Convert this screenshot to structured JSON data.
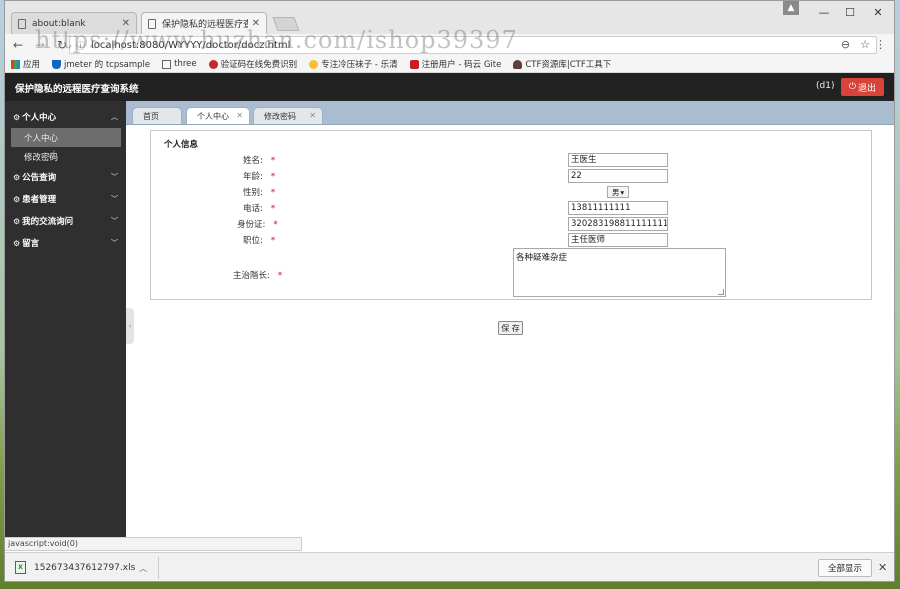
{
  "browser": {
    "tabs": [
      {
        "title": "about:blank"
      },
      {
        "title": "保护隐私的远程医疗查询"
      }
    ],
    "url": "localhost:8080/WYYYY/doctor/docz.html",
    "bookmarks": [
      {
        "label": "应用",
        "icon": "apps-icon"
      },
      {
        "label": "jmeter 的 tcpsample",
        "icon": "shield-icon"
      },
      {
        "label": "three",
        "icon": "page-icon"
      },
      {
        "label": "验证码在线免费识别",
        "icon": "captcha-icon"
      },
      {
        "label": "专注冷压袜子 - 乐清",
        "icon": "bird-icon"
      },
      {
        "label": "注册用户 - 码云 Gite",
        "icon": "gitee-icon"
      },
      {
        "label": "CTF资源库|CTF工具下",
        "icon": "person-icon"
      }
    ]
  },
  "app": {
    "title": "保护隐私的远程医疗查询系统",
    "user": "(d1)",
    "logout_label": "退出"
  },
  "sidebar": {
    "groups": [
      {
        "label": "个人中心",
        "expanded": true
      },
      {
        "label": "公告查询"
      },
      {
        "label": "患者管理"
      },
      {
        "label": "我的交流询问"
      },
      {
        "label": "留言"
      }
    ],
    "subitems": [
      {
        "label": "个人中心",
        "active": true
      },
      {
        "label": "修改密码"
      }
    ]
  },
  "content_tabs": [
    {
      "label": "首页"
    },
    {
      "label": "个人中心",
      "active": true
    },
    {
      "label": "修改密码"
    }
  ],
  "form": {
    "panel_title": "个人信息",
    "fields": {
      "name": {
        "label": "姓名:",
        "value": "王医生"
      },
      "age": {
        "label": "年龄:",
        "value": "22"
      },
      "gender": {
        "label": "性别:",
        "value": "男"
      },
      "phone": {
        "label": "电话:",
        "value": "13811111111"
      },
      "id_card": {
        "label": "身份证:",
        "value": "320283198811111111"
      },
      "position": {
        "label": "职位:",
        "value": "主任医师"
      },
      "specialty": {
        "label": "主治階长:",
        "value": "各种疑难杂症"
      }
    },
    "required_mark": "*",
    "save_label": "保 存"
  },
  "statusbar": {
    "text": "javascript:void(0)"
  },
  "downloads": {
    "file": "152673437612797.xls",
    "show_all_label": "全部显示"
  },
  "watermark": "https://www.huzhan.com/ishop39397"
}
